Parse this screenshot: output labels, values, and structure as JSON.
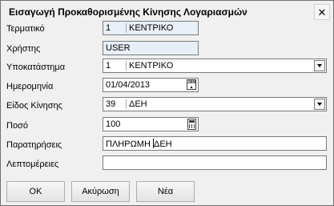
{
  "window": {
    "title": "Εισαγωγή Προκαθορισμένης Κίνησης Λογαριασμών",
    "close_glyph": "✕"
  },
  "form": {
    "terminal": {
      "label": "Τερματικό",
      "code": "1",
      "name": "ΚΕΝΤΡΙΚΟ"
    },
    "user": {
      "label": "Χρήστης",
      "value": "USER"
    },
    "branch": {
      "label": "Υποκατάστημα",
      "code": "1",
      "name": "ΚΕΝΤΡΙΚΟ"
    },
    "date": {
      "label": "Ημερομηνία",
      "value": "01/04/2013",
      "icon": "calendar-icon"
    },
    "movement_type": {
      "label": "Είδος Κίνησης",
      "code": "39",
      "name": "ΔΕΗ"
    },
    "amount": {
      "label": "Ποσό",
      "value": "100",
      "icon": "calculator-icon"
    },
    "remarks": {
      "label": "Παρατηρήσεις",
      "value_before_cursor": "ΠΛΗΡΩΜΗ ",
      "value_after_cursor": "ΔΕΗ"
    },
    "details": {
      "label": "Λεπτομέρειες",
      "value": ""
    }
  },
  "buttons": {
    "ok": "ΟΚ",
    "cancel": "Ακύρωση",
    "new": "Νέα"
  }
}
